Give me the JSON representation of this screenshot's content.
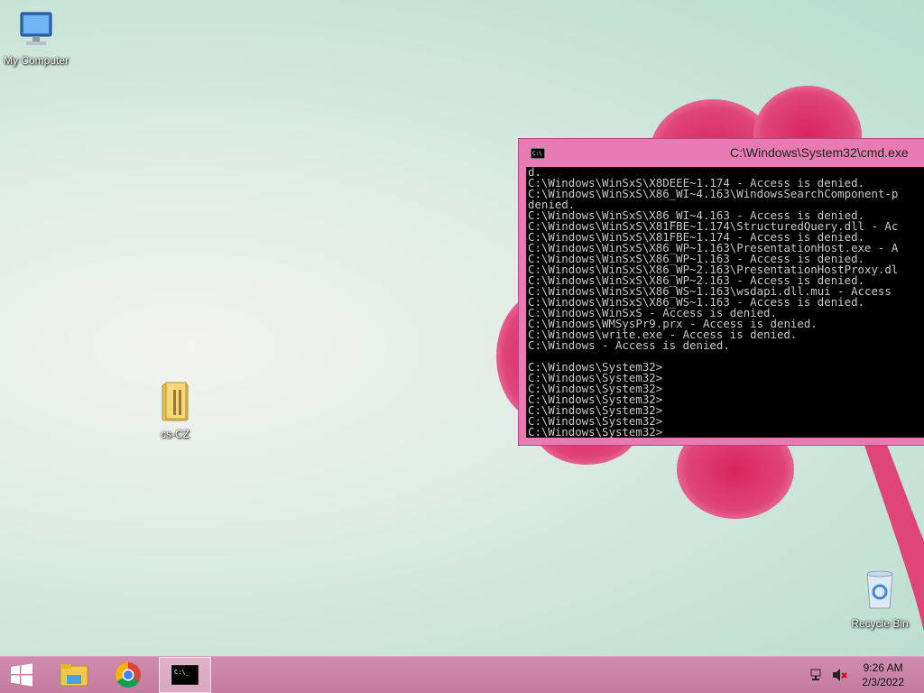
{
  "desktop": {
    "icons": [
      {
        "label": "My Computer"
      },
      {
        "label": "cs-CZ"
      },
      {
        "label": "Recycle Bin"
      }
    ]
  },
  "cmd": {
    "title": "C:\\Windows\\System32\\cmd.exe",
    "lines": [
      "d.",
      "C:\\Windows\\WinSxS\\X8DEEE~1.174 - Access is denied.",
      "C:\\Windows\\WinSxS\\X86_WI~4.163\\WindowsSearchComponent-p",
      "denied.",
      "C:\\Windows\\WinSxS\\X86_WI~4.163 - Access is denied.",
      "C:\\Windows\\WinSxS\\X81FBE~1.174\\StructuredQuery.dll - Ac",
      "C:\\Windows\\WinSxS\\X81FBE~1.174 - Access is denied.",
      "C:\\Windows\\WinSxS\\X86_WP~1.163\\PresentationHost.exe - A",
      "C:\\Windows\\WinSxS\\X86_WP~1.163 - Access is denied.",
      "C:\\Windows\\WinSxS\\X86_WP~2.163\\PresentationHostProxy.dl",
      "C:\\Windows\\WinSxS\\X86_WP~2.163 - Access is denied.",
      "C:\\Windows\\WinSxS\\X86_WS~1.163\\wsdapi.dll.mui - Access",
      "C:\\Windows\\WinSxS\\X86_WS~1.163 - Access is denied.",
      "C:\\Windows\\WinSxS - Access is denied.",
      "C:\\Windows\\WMSysPr9.prx - Access is denied.",
      "C:\\Windows\\write.exe - Access is denied.",
      "C:\\Windows - Access is denied.",
      "",
      "C:\\Windows\\System32>",
      "C:\\Windows\\System32>",
      "C:\\Windows\\System32>",
      "C:\\Windows\\System32>",
      "C:\\Windows\\System32>",
      "C:\\Windows\\System32>",
      "C:\\Windows\\System32>"
    ]
  },
  "taskbar": {
    "items": [
      {
        "name": "start-button",
        "icon": "windows-logo-icon"
      },
      {
        "name": "file-explorer-button",
        "icon": "folder-icon"
      },
      {
        "name": "chrome-button",
        "icon": "chrome-icon"
      },
      {
        "name": "cmd-taskbar-button",
        "icon": "cmd-icon",
        "active": true
      }
    ],
    "tray": {
      "network_icon": "network-icon",
      "volume_icon": "volume-muted-icon"
    },
    "clock": {
      "time": "9:26 AM",
      "date": "2/3/2022"
    }
  },
  "colors": {
    "window_frame": "#e77bb2",
    "taskbar": "#c57aa0",
    "console_bg": "#000000",
    "console_text": "#c8c8c8"
  }
}
